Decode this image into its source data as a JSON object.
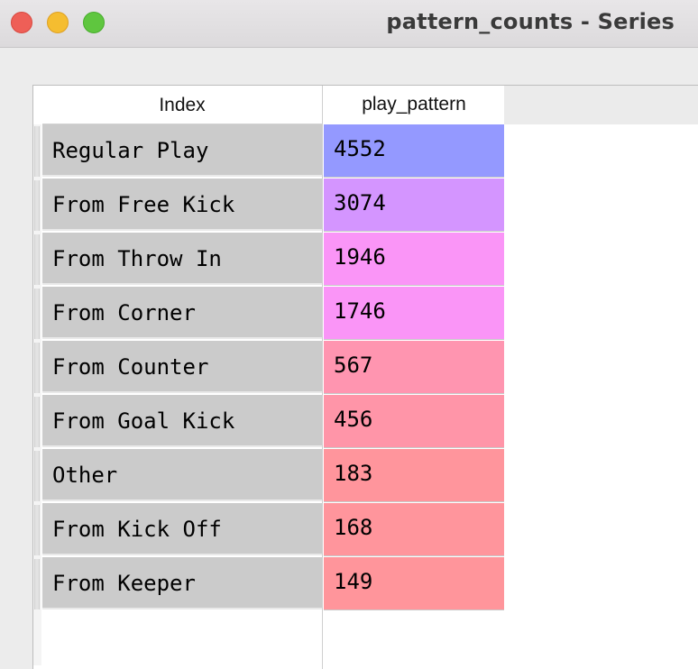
{
  "window": {
    "title": "pattern_counts - Series"
  },
  "table": {
    "columns": [
      "Index",
      "play_pattern"
    ],
    "rows": [
      {
        "index": "Regular Play",
        "value": "4552",
        "color": "#9499ff"
      },
      {
        "index": "From Free Kick",
        "value": "3074",
        "color": "#d495ff"
      },
      {
        "index": "From Throw In",
        "value": "1946",
        "color": "#fa95f7"
      },
      {
        "index": "From Corner",
        "value": "1746",
        "color": "#fa95f7"
      },
      {
        "index": "From Counter",
        "value": "567",
        "color": "#ff95b0"
      },
      {
        "index": "From Goal Kick",
        "value": "456",
        "color": "#ff95a8"
      },
      {
        "index": "Other",
        "value": "183",
        "color": "#ff959c"
      },
      {
        "index": "From Kick Off",
        "value": "168",
        "color": "#ff959c"
      },
      {
        "index": "From Keeper",
        "value": "149",
        "color": "#ff959b"
      }
    ]
  }
}
